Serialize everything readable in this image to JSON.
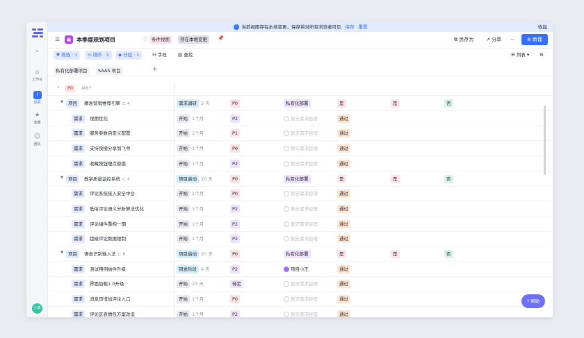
{
  "banner": {
    "text": "当前视图存在本地变更，保存将对所有浏览者可见",
    "save": "保存",
    "reset": "重置",
    "close": "收起"
  },
  "header": {
    "title": "本季度规划项目",
    "view_tag": "条件视图",
    "local_tag": "存在本地变更",
    "saveas": "另存为",
    "share": "分享",
    "more": "···",
    "new": "新建"
  },
  "toolbar": {
    "filter": "筛选 · 1",
    "sort": "排序 · 1",
    "group": "分组 · 1",
    "fields": "字段",
    "find": "查找",
    "view": "列表"
  },
  "rail": {
    "items": [
      "工作台",
      "空间",
      "收藏",
      "团队"
    ],
    "avatar": "小李"
  },
  "tabs": [
    "私有化部署项目",
    "SAAS 项目"
  ],
  "group": {
    "label": "P0",
    "count": "共8个"
  },
  "rows": [
    {
      "kind": "project",
      "type": "项目",
      "name": "精准营销推荐引擎",
      "sub": "4",
      "stage": "需求调研",
      "dur": "3 天",
      "pri": "P0",
      "owner": "私有化部署",
      "a": "是",
      "b": "是",
      "c": "否"
    },
    {
      "kind": "item",
      "type": "需求",
      "name": "视图优化",
      "stage": "开始",
      "dur": "1个月",
      "pri": "P2",
      "owner": "暂无需求经理",
      "status": "通过"
    },
    {
      "kind": "item",
      "type": "需求",
      "name": "服务参数自定义配置",
      "stage": "开始",
      "dur": "1个月",
      "pri": "P1",
      "owner": "暂无需求经理",
      "status": "通过"
    },
    {
      "kind": "item",
      "type": "需求",
      "name": "支持快捷分享到飞书",
      "stage": "开始",
      "dur": "1个月",
      "pri": "P0",
      "owner": "暂无需求经理",
      "status": "通过"
    },
    {
      "kind": "item",
      "type": "需求",
      "name": "收藏按钮埋点替换",
      "stage": "开始",
      "dur": "1个月",
      "pri": "P2",
      "owner": "暂无需求经理",
      "status": "通过"
    },
    {
      "kind": "project",
      "type": "项目",
      "name": "教学质量监控系统",
      "sub": "4",
      "stage": "项目启动",
      "dur": "20 天",
      "pri": "P0",
      "owner": "私有化部署",
      "a": "是",
      "b": "是",
      "c": "否"
    },
    {
      "kind": "item",
      "type": "需求",
      "name": "评论系统接入安全中台",
      "stage": "开始",
      "dur": "1个月",
      "pri": "P0",
      "owner": "暂无需求经理",
      "status": "通过"
    },
    {
      "kind": "item",
      "type": "需求",
      "name": "低俗评论语义分析算法优化",
      "stage": "开始",
      "dur": "1个月",
      "pri": "P2",
      "owner": "暂无需求经理",
      "status": "通过"
    },
    {
      "kind": "item",
      "type": "需求",
      "name": "评论组件重构一期",
      "stage": "开始",
      "dur": "1个月",
      "pri": "P2",
      "owner": "暂无需求经理",
      "status": "通过"
    },
    {
      "kind": "item",
      "type": "需求",
      "name": "超级评论数据限制",
      "stage": "开始",
      "dur": "1个月",
      "pri": "P2",
      "owner": "暂无需求经理",
      "status": "通过"
    },
    {
      "kind": "project",
      "type": "项目",
      "name": "语音识别输入法",
      "sub": "6",
      "stage": "项目启动",
      "dur": "20 天",
      "pri": "P0",
      "owner": "私有化部署",
      "a": "是",
      "b": "是",
      "c": "否"
    },
    {
      "kind": "item",
      "type": "需求",
      "name": "测试用例插件升级",
      "stage": "研发阶段",
      "dur": "4 天",
      "pri": "P2",
      "owner": "项目小王",
      "status": "通过",
      "has": true
    },
    {
      "kind": "item",
      "type": "需求",
      "name": "界面加载1.0升级",
      "stage": "开始",
      "dur": "23 天",
      "pri": "待定",
      "owner": "暂无需求经理",
      "status": "通过"
    },
    {
      "kind": "item",
      "type": "需求",
      "name": "消息页增加评论入口",
      "stage": "开始",
      "dur": "1个月",
      "pri": "P0",
      "owner": "暂无需求经理",
      "status": "通过"
    },
    {
      "kind": "item",
      "type": "需求",
      "name": "评论区表情包方案改造",
      "stage": "开始",
      "dur": "1个月",
      "pri": "P2",
      "owner": "暂无需求经理",
      "status": "通过"
    }
  ],
  "help": "帮助",
  "colors": {
    "accent": "#3370ff",
    "p0": "#fde2e4",
    "p1": "#fde2f0",
    "p2": "#f0e2fd",
    "stage_start": "#e8eaed",
    "stage_blue": "#d4effb",
    "pass": "#fde6d4",
    "yes": "#fde2ef",
    "no": "#d6f4ec"
  }
}
